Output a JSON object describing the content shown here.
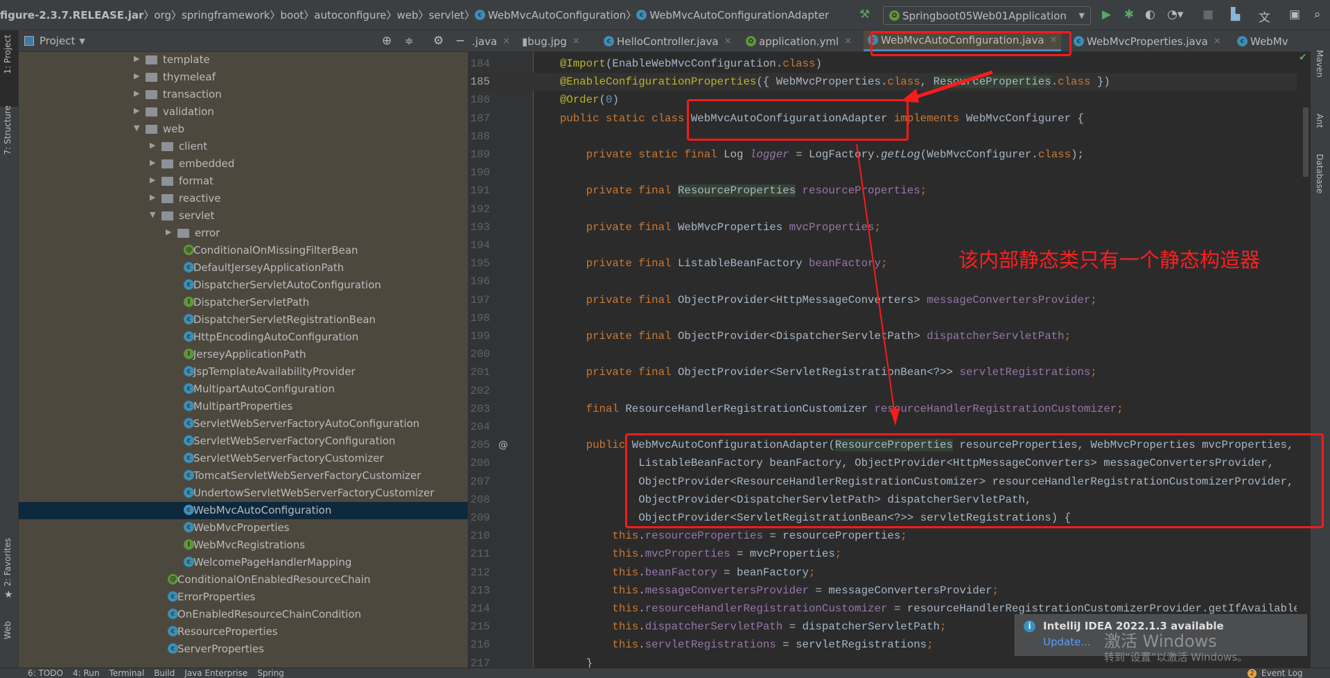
{
  "breadcrumb": [
    "figure-2.3.7.RELEASE.jar",
    "org",
    "springframework",
    "boot",
    "autoconfigure",
    "web",
    "servlet",
    "WebMvcAutoConfiguration",
    "WebMvcAutoConfigurationAdapter"
  ],
  "toolbar": {
    "run_config": "Springboot05Web01Application",
    "icons": [
      "hammer-icon",
      "run-icon",
      "debug-icon",
      "coverage-icon",
      "profile-icon",
      "stop-icon",
      "project-structure-icon",
      "translate-icon",
      "layout-icon",
      "search-icon"
    ]
  },
  "left_stripe": {
    "project": "1: Project",
    "structure": "7: Structure",
    "favorites": "2: Favorites",
    "web": "Web"
  },
  "right_stripe": {
    "maven": "Maven",
    "ant": "Ant",
    "database": "Database"
  },
  "project_panel": {
    "title": "Project",
    "tree": [
      {
        "label": "template",
        "type": "folder",
        "level": 0,
        "expanded": false
      },
      {
        "label": "thymeleaf",
        "type": "folder",
        "level": 0,
        "expanded": false
      },
      {
        "label": "transaction",
        "type": "folder",
        "level": 0,
        "expanded": false
      },
      {
        "label": "validation",
        "type": "folder",
        "level": 0,
        "expanded": false
      },
      {
        "label": "web",
        "type": "folder",
        "level": 0,
        "expanded": true
      },
      {
        "label": "client",
        "type": "folder",
        "level": 1,
        "expanded": false
      },
      {
        "label": "embedded",
        "type": "folder",
        "level": 1,
        "expanded": false
      },
      {
        "label": "format",
        "type": "folder",
        "level": 1,
        "expanded": false
      },
      {
        "label": "reactive",
        "type": "folder",
        "level": 1,
        "expanded": false
      },
      {
        "label": "servlet",
        "type": "folder",
        "level": 1,
        "expanded": true
      },
      {
        "label": "error",
        "type": "folder",
        "level": 2,
        "expanded": false
      },
      {
        "label": "ConditionalOnMissingFilterBean",
        "type": "annotation",
        "level": 2
      },
      {
        "label": "DefaultJerseyApplicationPath",
        "type": "class",
        "level": 2
      },
      {
        "label": "DispatcherServletAutoConfiguration",
        "type": "class",
        "level": 2
      },
      {
        "label": "DispatcherServletPath",
        "type": "interface",
        "level": 2
      },
      {
        "label": "DispatcherServletRegistrationBean",
        "type": "class",
        "level": 2
      },
      {
        "label": "HttpEncodingAutoConfiguration",
        "type": "class",
        "level": 2
      },
      {
        "label": "JerseyApplicationPath",
        "type": "interface",
        "level": 2
      },
      {
        "label": "JspTemplateAvailabilityProvider",
        "type": "class",
        "level": 2
      },
      {
        "label": "MultipartAutoConfiguration",
        "type": "class",
        "level": 2
      },
      {
        "label": "MultipartProperties",
        "type": "class",
        "level": 2
      },
      {
        "label": "ServletWebServerFactoryAutoConfiguration",
        "type": "class",
        "level": 2
      },
      {
        "label": "ServletWebServerFactoryConfiguration",
        "type": "class",
        "level": 2
      },
      {
        "label": "ServletWebServerFactoryCustomizer",
        "type": "class",
        "level": 2
      },
      {
        "label": "TomcatServletWebServerFactoryCustomizer",
        "type": "class",
        "level": 2
      },
      {
        "label": "UndertowServletWebServerFactoryCustomizer",
        "type": "class",
        "level": 2
      },
      {
        "label": "WebMvcAutoConfiguration",
        "type": "class",
        "level": 2,
        "selected": true
      },
      {
        "label": "WebMvcProperties",
        "type": "class",
        "level": 2
      },
      {
        "label": "WebMvcRegistrations",
        "type": "interface",
        "level": 2
      },
      {
        "label": "WelcomePageHandlerMapping",
        "type": "class",
        "level": 2
      },
      {
        "label": "ConditionalOnEnabledResourceChain",
        "type": "annotation",
        "level": 1
      },
      {
        "label": "ErrorProperties",
        "type": "class",
        "level": 1
      },
      {
        "label": "OnEnabledResourceChainCondition",
        "type": "class",
        "level": 1
      },
      {
        "label": "ResourceProperties",
        "type": "class",
        "level": 1
      },
      {
        "label": "ServerProperties",
        "type": "class",
        "level": 1
      }
    ]
  },
  "editor_tabs": [
    {
      "label": ".java",
      "icon": "none"
    },
    {
      "label": "bug.jpg",
      "icon": "image"
    },
    {
      "label": "HelloController.java",
      "icon": "class"
    },
    {
      "label": "application.yml",
      "icon": "spring"
    },
    {
      "label": "WebMvcAutoConfiguration.java",
      "icon": "class",
      "active": true
    },
    {
      "label": "WebMvcProperties.java",
      "icon": "class"
    },
    {
      "label": "WebMv",
      "icon": "class"
    }
  ],
  "code": {
    "current_line": "185",
    "lines": [
      {
        "n": "184",
        "t": [
          [
            "    ",
            ""
          ],
          [
            "@Import",
            "a"
          ],
          [
            "(EnableWebMvcConfiguration.",
            ""
          ],
          [
            "class",
            "k"
          ],
          [
            ")",
            ""
          ]
        ]
      },
      {
        "n": "185",
        "t": [
          [
            "    ",
            ""
          ],
          [
            "@EnableConfigurationProperties",
            "a"
          ],
          [
            "({ WebMvcProperties.",
            ""
          ],
          [
            "class",
            "k"
          ],
          [
            ", ",
            ""
          ],
          [
            "ResourceProperties",
            "h"
          ],
          [
            ".",
            ""
          ],
          [
            "class",
            "k"
          ],
          [
            " })",
            ""
          ]
        ]
      },
      {
        "n": "186",
        "t": [
          [
            "    ",
            ""
          ],
          [
            "@Order",
            "a"
          ],
          [
            "(",
            ""
          ],
          [
            "0",
            "n"
          ],
          [
            ")",
            ""
          ]
        ]
      },
      {
        "n": "187",
        "t": [
          [
            "    ",
            ""
          ],
          [
            "public static class ",
            "k"
          ],
          [
            "WebMvcAutoConfigurationAdapter ",
            ""
          ],
          [
            "implements ",
            "k"
          ],
          [
            "WebMvcConfigurer {",
            ""
          ]
        ]
      },
      {
        "n": "188",
        "t": []
      },
      {
        "n": "189",
        "t": [
          [
            "        ",
            ""
          ],
          [
            "private static final ",
            "k"
          ],
          [
            "Log ",
            ""
          ],
          [
            "logger",
            "fi"
          ],
          [
            " = LogFactory.",
            ""
          ],
          [
            "getLog",
            "i"
          ],
          [
            "(WebMvcConfigurer.",
            ""
          ],
          [
            "class",
            "k"
          ],
          [
            ");",
            ""
          ]
        ]
      },
      {
        "n": "190",
        "t": []
      },
      {
        "n": "191",
        "t": [
          [
            "        ",
            ""
          ],
          [
            "private final ",
            "k"
          ],
          [
            "ResourceProperties",
            "h"
          ],
          [
            " ",
            ""
          ],
          [
            "resourceProperties",
            "f"
          ],
          [
            ";",
            "k"
          ]
        ]
      },
      {
        "n": "192",
        "t": []
      },
      {
        "n": "193",
        "t": [
          [
            "        ",
            ""
          ],
          [
            "private final ",
            "k"
          ],
          [
            "WebMvcProperties ",
            ""
          ],
          [
            "mvcProperties",
            "f"
          ],
          [
            ";",
            "k"
          ]
        ]
      },
      {
        "n": "194",
        "t": []
      },
      {
        "n": "195",
        "t": [
          [
            "        ",
            ""
          ],
          [
            "private final ",
            "k"
          ],
          [
            "ListableBeanFactory ",
            ""
          ],
          [
            "beanFactory",
            "f"
          ],
          [
            ";",
            "k"
          ]
        ]
      },
      {
        "n": "196",
        "t": []
      },
      {
        "n": "197",
        "t": [
          [
            "        ",
            ""
          ],
          [
            "private final ",
            "k"
          ],
          [
            "ObjectProvider<HttpMessageConverters> ",
            ""
          ],
          [
            "messageConvertersProvider",
            "f"
          ],
          [
            ";",
            "k"
          ]
        ]
      },
      {
        "n": "198",
        "t": []
      },
      {
        "n": "199",
        "t": [
          [
            "        ",
            ""
          ],
          [
            "private final ",
            "k"
          ],
          [
            "ObjectProvider<DispatcherServletPath> ",
            ""
          ],
          [
            "dispatcherServletPath",
            "f"
          ],
          [
            ";",
            "k"
          ]
        ]
      },
      {
        "n": "200",
        "t": []
      },
      {
        "n": "201",
        "t": [
          [
            "        ",
            ""
          ],
          [
            "private final ",
            "k"
          ],
          [
            "ObjectProvider<ServletRegistrationBean<?>> ",
            ""
          ],
          [
            "servletRegistrations",
            "f"
          ],
          [
            ";",
            "k"
          ]
        ]
      },
      {
        "n": "202",
        "t": []
      },
      {
        "n": "203",
        "t": [
          [
            "        ",
            ""
          ],
          [
            "final ",
            "k"
          ],
          [
            "ResourceHandlerRegistrationCustomizer ",
            ""
          ],
          [
            "resourceHandlerRegistrationCustomizer",
            "f"
          ],
          [
            ";",
            "k"
          ]
        ]
      },
      {
        "n": "204",
        "t": []
      },
      {
        "n": "205",
        "t": [
          [
            "        ",
            ""
          ],
          [
            "public ",
            "k"
          ],
          [
            "WebMvcAutoConfigurationAdapter(",
            ""
          ],
          [
            "ResourceProperties",
            "h"
          ],
          [
            " resourceProperties, WebMvcProperties mvcProperties,",
            ""
          ]
        ]
      },
      {
        "n": "206",
        "t": [
          [
            "                ListableBeanFactory beanFactory, ObjectProvider<HttpMessageConverters> messageConvertersProvider,",
            ""
          ]
        ]
      },
      {
        "n": "207",
        "t": [
          [
            "                ObjectProvider<ResourceHandlerRegistrationCustomizer> resourceHandlerRegistrationCustomizerProvider,",
            ""
          ]
        ]
      },
      {
        "n": "208",
        "t": [
          [
            "                ObjectProvider<DispatcherServletPath> dispatcherServletPath,",
            ""
          ]
        ]
      },
      {
        "n": "209",
        "t": [
          [
            "                ObjectProvider<ServletRegistrationBean<?>> servletRegistrations) {",
            ""
          ]
        ]
      },
      {
        "n": "210",
        "t": [
          [
            "            ",
            ""
          ],
          [
            "this",
            "k"
          ],
          [
            ".",
            ""
          ],
          [
            "resourceProperties",
            "f"
          ],
          [
            " = resourceProperties",
            ""
          ],
          [
            ";",
            "k"
          ]
        ]
      },
      {
        "n": "211",
        "t": [
          [
            "            ",
            ""
          ],
          [
            "this",
            "k"
          ],
          [
            ".",
            ""
          ],
          [
            "mvcProperties",
            "f"
          ],
          [
            " = mvcProperties",
            ""
          ],
          [
            ";",
            "k"
          ]
        ]
      },
      {
        "n": "212",
        "t": [
          [
            "            ",
            ""
          ],
          [
            "this",
            "k"
          ],
          [
            ".",
            ""
          ],
          [
            "beanFactory",
            "f"
          ],
          [
            " = beanFactory",
            ""
          ],
          [
            ";",
            "k"
          ]
        ]
      },
      {
        "n": "213",
        "t": [
          [
            "            ",
            ""
          ],
          [
            "this",
            "k"
          ],
          [
            ".",
            ""
          ],
          [
            "messageConvertersProvider",
            "f"
          ],
          [
            " = messageConvertersProvider",
            ""
          ],
          [
            ";",
            "k"
          ]
        ]
      },
      {
        "n": "214",
        "t": [
          [
            "            ",
            ""
          ],
          [
            "this",
            "k"
          ],
          [
            ".",
            ""
          ],
          [
            "resourceHandlerRegistrationCustomizer",
            "f"
          ],
          [
            " = resourceHandlerRegistrationCustomizerProvider.getIfAvailable();",
            ""
          ]
        ]
      },
      {
        "n": "215",
        "t": [
          [
            "            ",
            ""
          ],
          [
            "this",
            "k"
          ],
          [
            ".",
            ""
          ],
          [
            "dispatcherServletPath",
            "f"
          ],
          [
            " = dispatcherServletPath",
            ""
          ],
          [
            ";",
            "k"
          ]
        ]
      },
      {
        "n": "216",
        "t": [
          [
            "            ",
            ""
          ],
          [
            "this",
            "k"
          ],
          [
            ".",
            ""
          ],
          [
            "servletRegistrations",
            "f"
          ],
          [
            " = servletRegistrations",
            ""
          ],
          [
            ";",
            "k"
          ]
        ]
      },
      {
        "n": "217",
        "t": [
          [
            "        }",
            ""
          ]
        ]
      }
    ]
  },
  "annotation": {
    "text": "该内部静态类只有一个静态构造器",
    "color": "#ff1e1e"
  },
  "notification": {
    "title": "IntelliJ IDEA 2022.1.3 available",
    "link": "Update..."
  },
  "watermark": {
    "line1": "激活 Windows",
    "line2": "转到“设置”以激活 Windows。"
  },
  "status_bar": {
    "items": [
      "6: TODO",
      "4: Run",
      "Terminal",
      "Build",
      "Java Enterprise",
      "Spring"
    ],
    "event_log": "Event Log",
    "event_count": "2"
  },
  "colors": {
    "keyword": "#cc7832",
    "annotation": "#bbb529",
    "field": "#9876aa",
    "text": "#a9b7c6",
    "selection": "#0d293e",
    "accent": "#4a88c7",
    "highlight_box": "#ff1a1a"
  }
}
